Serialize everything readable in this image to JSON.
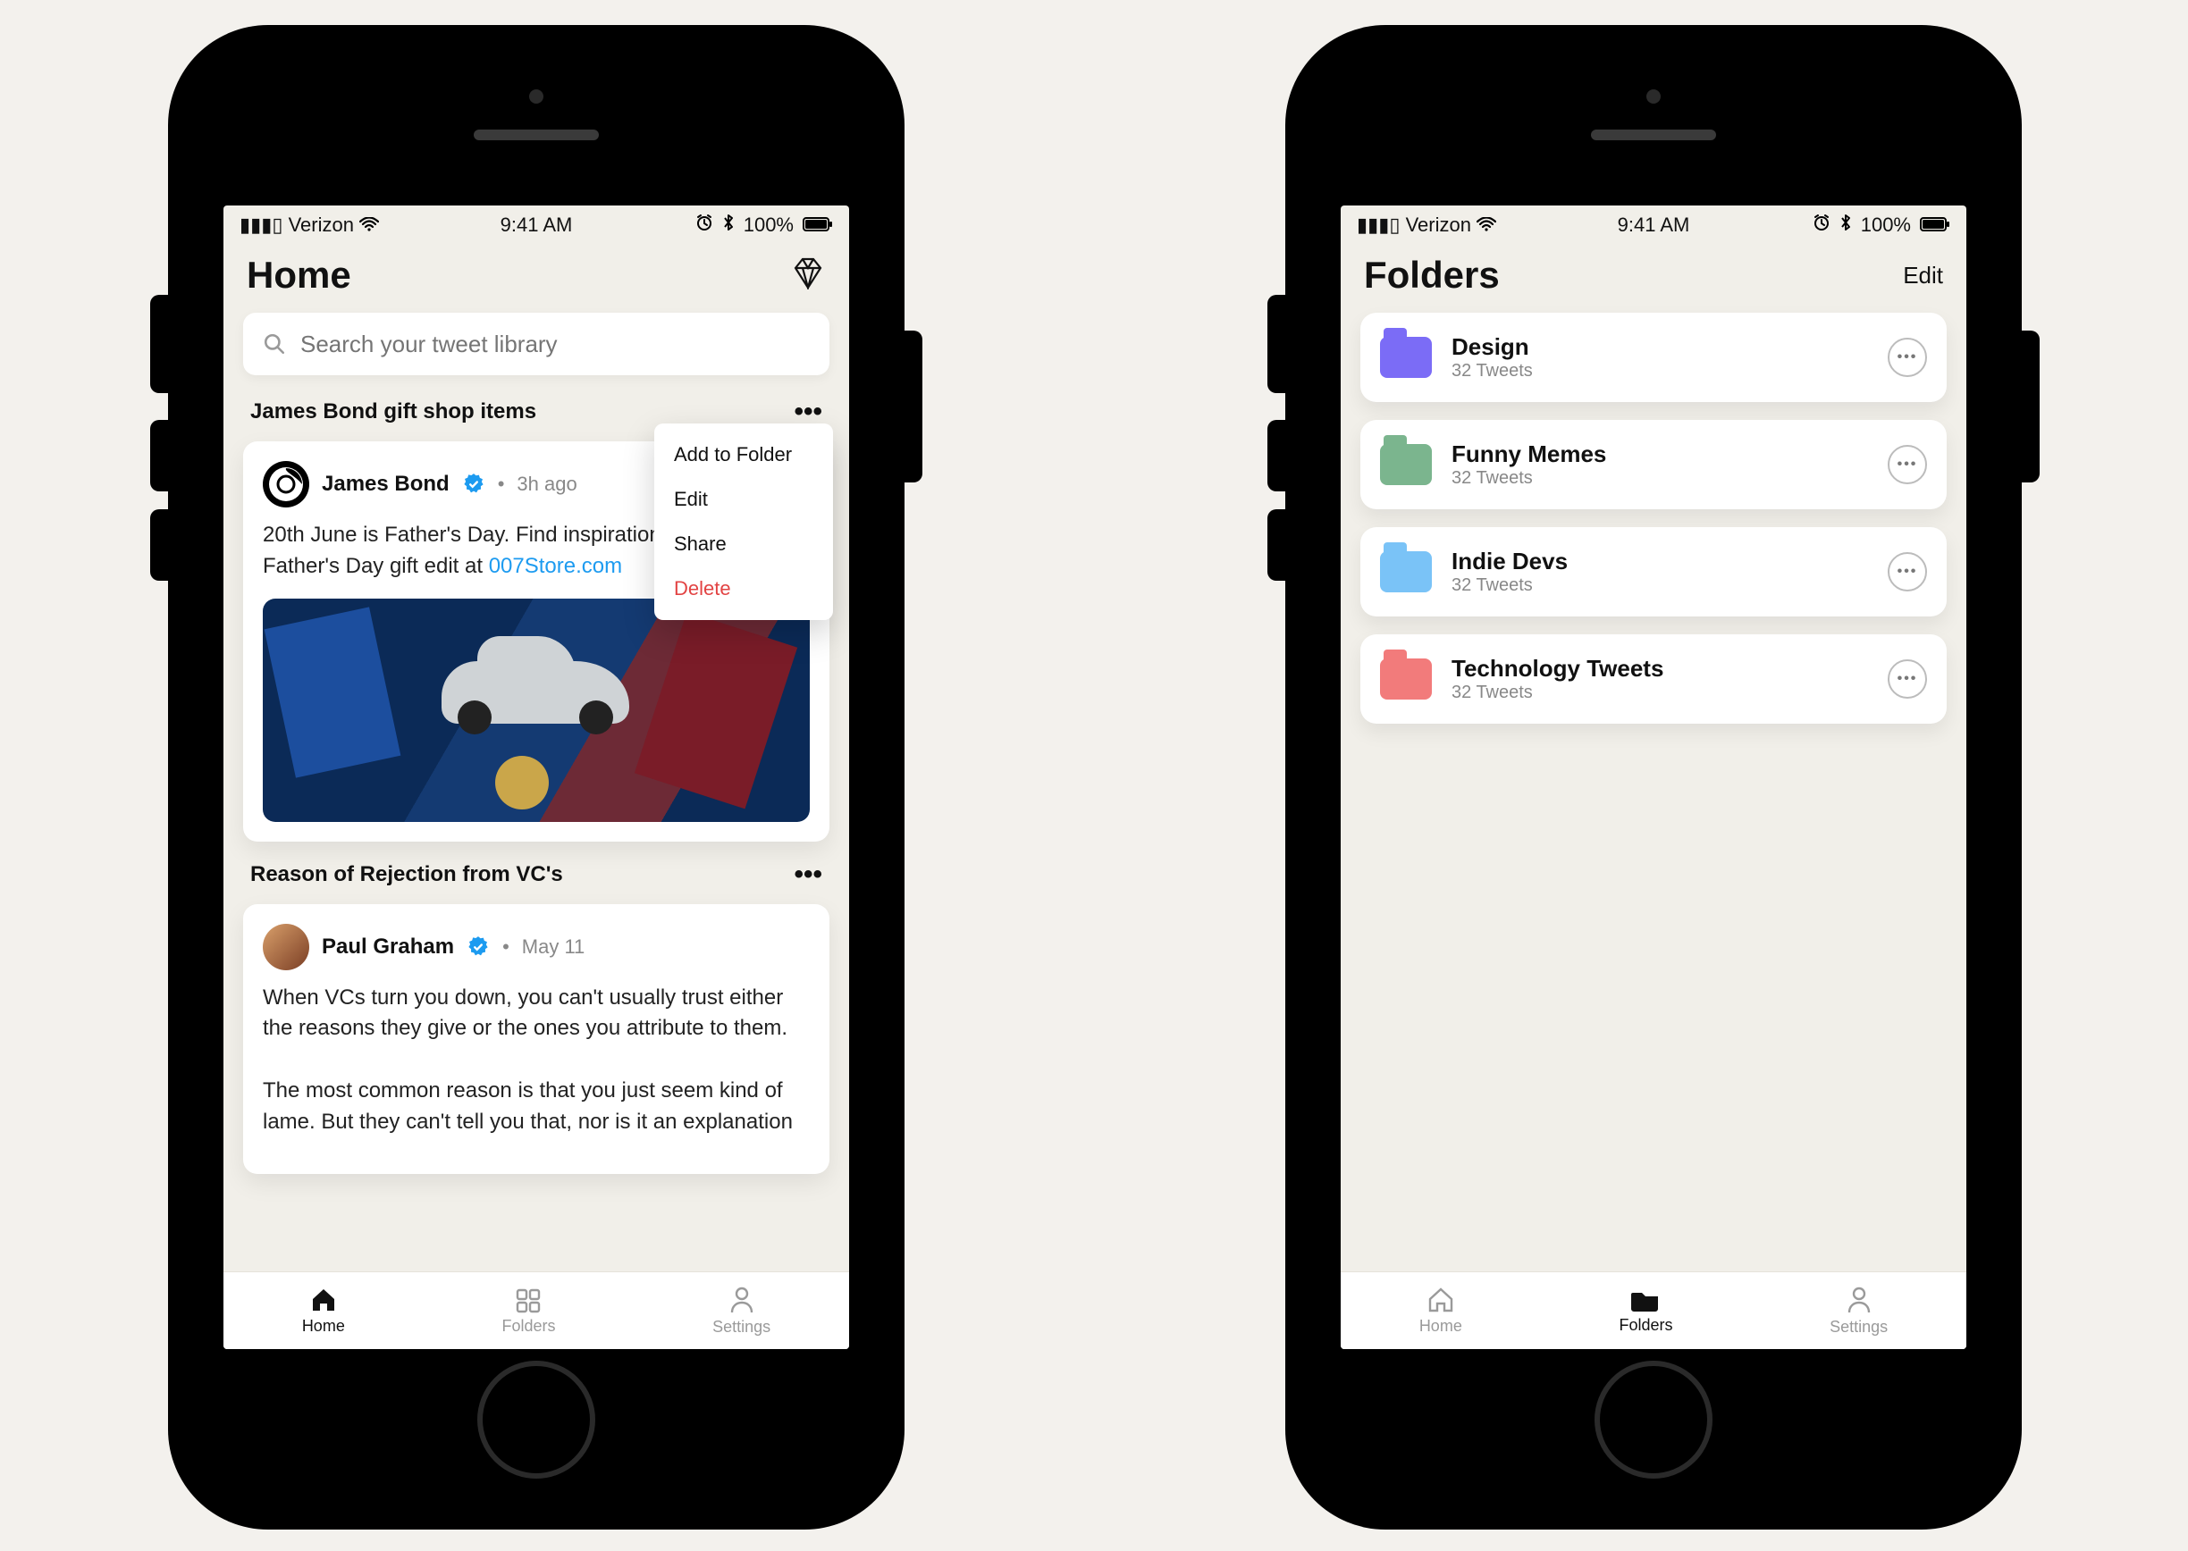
{
  "status": {
    "carrier": "Verizon",
    "time": "9:41 AM",
    "battery": "100%"
  },
  "homeScreen": {
    "title": "Home",
    "search_placeholder": "Search your tweet library",
    "menu": [
      "Add to Folder",
      "Edit",
      "Share",
      "Delete"
    ],
    "posts": [
      {
        "section": "James Bond gift shop items",
        "author": "James Bond",
        "time": "3h ago",
        "body_prefix": "20th June is Father's Day. Find inspiration with our Father's Day gift edit at ",
        "body_link": "007Store.com"
      },
      {
        "section": "Reason of Rejection from VC's",
        "author": "Paul Graham",
        "time": "May 11",
        "body": "When VCs turn you down, you can't usually trust either the reasons they give or the ones you attribute to them.\n\nThe most common reason is that you just seem kind of lame. But they can't tell you that, nor is it an explanation"
      }
    ],
    "tabs": {
      "home": "Home",
      "folders": "Folders",
      "settings": "Settings"
    }
  },
  "foldersScreen": {
    "title": "Folders",
    "action": "Edit",
    "items": [
      {
        "name": "Design",
        "count": "32 Tweets",
        "color": "#7b6cf6"
      },
      {
        "name": "Funny Memes",
        "count": "32 Tweets",
        "color": "#7bb58e"
      },
      {
        "name": "Indie Devs",
        "count": "32 Tweets",
        "color": "#7ac3f7"
      },
      {
        "name": "Technology Tweets",
        "count": "32 Tweets",
        "color": "#f27b7b"
      }
    ],
    "tabs": {
      "home": "Home",
      "folders": "Folders",
      "settings": "Settings"
    }
  }
}
